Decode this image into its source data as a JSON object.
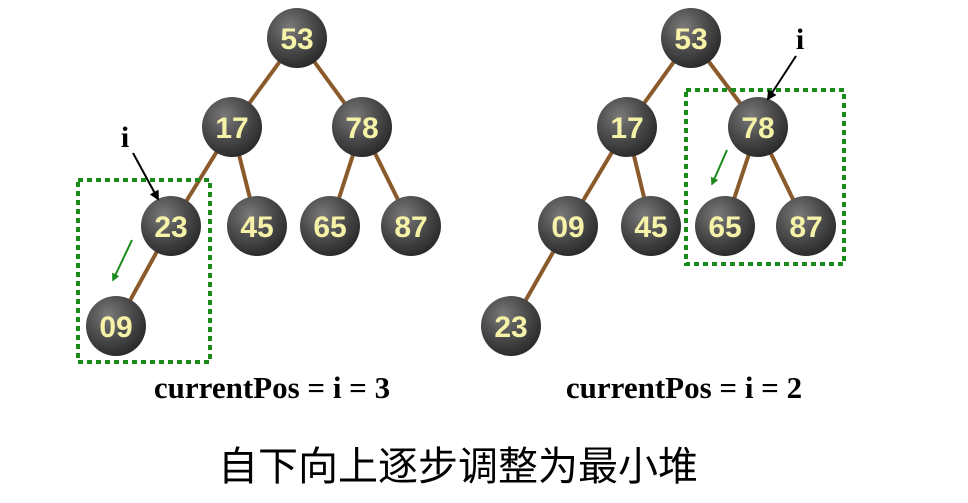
{
  "colors": {
    "node_fill": "#4b4b4b",
    "node_text": "#f6f2a8",
    "edge": "#8b5a2b",
    "highlight_box": "#1a8a1a",
    "arrow": "#1a8a1a"
  },
  "trees": [
    {
      "caption": "currentPos = i = 3",
      "marker_label": "i",
      "nodes": [
        {
          "id": "a1",
          "label": "53"
        },
        {
          "id": "a2",
          "label": "17"
        },
        {
          "id": "a3",
          "label": "78"
        },
        {
          "id": "a4",
          "label": "23"
        },
        {
          "id": "a5",
          "label": "45"
        },
        {
          "id": "a6",
          "label": "65"
        },
        {
          "id": "a7",
          "label": "87"
        },
        {
          "id": "a8",
          "label": "09"
        }
      ]
    },
    {
      "caption": "currentPos = i = 2",
      "marker_label": "i",
      "nodes": [
        {
          "id": "b1",
          "label": "53"
        },
        {
          "id": "b2",
          "label": "17"
        },
        {
          "id": "b3",
          "label": "78"
        },
        {
          "id": "b4",
          "label": "09"
        },
        {
          "id": "b5",
          "label": "45"
        },
        {
          "id": "b6",
          "label": "65"
        },
        {
          "id": "b7",
          "label": "87"
        },
        {
          "id": "b8",
          "label": "23"
        }
      ]
    }
  ],
  "heading": "自下向上逐步调整为最小堆"
}
